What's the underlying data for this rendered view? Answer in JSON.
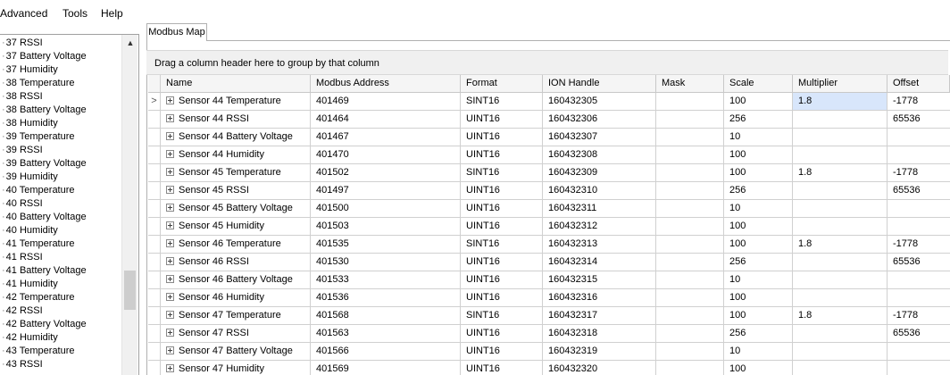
{
  "menu": [
    "Advanced",
    "Tools",
    "Help"
  ],
  "tree": [
    "37 RSSI",
    "37 Battery Voltage",
    "37 Humidity",
    "38 Temperature",
    "38 RSSI",
    "38 Battery Voltage",
    "38 Humidity",
    "39 Temperature",
    "39 RSSI",
    "39 Battery Voltage",
    "39 Humidity",
    "40 Temperature",
    "40 RSSI",
    "40 Battery Voltage",
    "40 Humidity",
    "41 Temperature",
    "41 RSSI",
    "41 Battery Voltage",
    "41 Humidity",
    "42 Temperature",
    "42 RSSI",
    "42 Battery Voltage",
    "42 Humidity",
    "43 Temperature",
    "43 RSSI"
  ],
  "tab_label": "Modbus Map",
  "group_hint": "Drag a column header here to group by that column",
  "columns": {
    "name": "Name",
    "address": "Modbus Address",
    "format": "Format",
    "ion": "ION Handle",
    "mask": "Mask",
    "scale": "Scale",
    "multiplier": "Multiplier",
    "offset": "Offset"
  },
  "current_row_marker": ">",
  "rows": [
    {
      "name": "Sensor 44 Temperature",
      "address": "401469",
      "format": "SINT16",
      "ion": "160432305",
      "mask": "",
      "scale": "100",
      "multiplier": "1.8",
      "offset": "-1778"
    },
    {
      "name": "Sensor 44 RSSI",
      "address": "401464",
      "format": "UINT16",
      "ion": "160432306",
      "mask": "",
      "scale": "256",
      "multiplier": "",
      "offset": "65536"
    },
    {
      "name": "Sensor 44 Battery Voltage",
      "address": "401467",
      "format": "UINT16",
      "ion": "160432307",
      "mask": "",
      "scale": "10",
      "multiplier": "",
      "offset": ""
    },
    {
      "name": "Sensor 44 Humidity",
      "address": "401470",
      "format": "UINT16",
      "ion": "160432308",
      "mask": "",
      "scale": "100",
      "multiplier": "",
      "offset": ""
    },
    {
      "name": "Sensor 45 Temperature",
      "address": "401502",
      "format": "SINT16",
      "ion": "160432309",
      "mask": "",
      "scale": "100",
      "multiplier": "1.8",
      "offset": "-1778"
    },
    {
      "name": "Sensor 45 RSSI",
      "address": "401497",
      "format": "UINT16",
      "ion": "160432310",
      "mask": "",
      "scale": "256",
      "multiplier": "",
      "offset": "65536"
    },
    {
      "name": "Sensor 45 Battery Voltage",
      "address": "401500",
      "format": "UINT16",
      "ion": "160432311",
      "mask": "",
      "scale": "10",
      "multiplier": "",
      "offset": ""
    },
    {
      "name": "Sensor 45 Humidity",
      "address": "401503",
      "format": "UINT16",
      "ion": "160432312",
      "mask": "",
      "scale": "100",
      "multiplier": "",
      "offset": ""
    },
    {
      "name": "Sensor 46 Temperature",
      "address": "401535",
      "format": "SINT16",
      "ion": "160432313",
      "mask": "",
      "scale": "100",
      "multiplier": "1.8",
      "offset": "-1778"
    },
    {
      "name": "Sensor 46 RSSI",
      "address": "401530",
      "format": "UINT16",
      "ion": "160432314",
      "mask": "",
      "scale": "256",
      "multiplier": "",
      "offset": "65536"
    },
    {
      "name": "Sensor 46 Battery Voltage",
      "address": "401533",
      "format": "UINT16",
      "ion": "160432315",
      "mask": "",
      "scale": "10",
      "multiplier": "",
      "offset": ""
    },
    {
      "name": "Sensor 46 Humidity",
      "address": "401536",
      "format": "UINT16",
      "ion": "160432316",
      "mask": "",
      "scale": "100",
      "multiplier": "",
      "offset": ""
    },
    {
      "name": "Sensor 47 Temperature",
      "address": "401568",
      "format": "SINT16",
      "ion": "160432317",
      "mask": "",
      "scale": "100",
      "multiplier": "1.8",
      "offset": "-1778"
    },
    {
      "name": "Sensor 47 RSSI",
      "address": "401563",
      "format": "UINT16",
      "ion": "160432318",
      "mask": "",
      "scale": "256",
      "multiplier": "",
      "offset": "65536"
    },
    {
      "name": "Sensor 47 Battery Voltage",
      "address": "401566",
      "format": "UINT16",
      "ion": "160432319",
      "mask": "",
      "scale": "10",
      "multiplier": "",
      "offset": ""
    },
    {
      "name": "Sensor 47 Humidity",
      "address": "401569",
      "format": "UINT16",
      "ion": "160432320",
      "mask": "",
      "scale": "100",
      "multiplier": "",
      "offset": ""
    }
  ],
  "selection_color": "#d8e6fb"
}
